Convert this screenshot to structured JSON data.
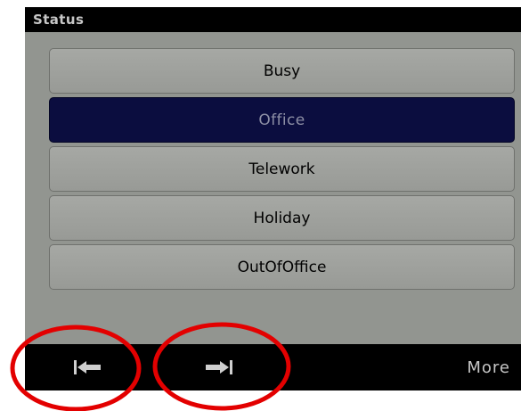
{
  "header": {
    "title": "Status"
  },
  "status_options": [
    {
      "label": "Busy",
      "selected": false
    },
    {
      "label": "Office",
      "selected": true
    },
    {
      "label": "Telework",
      "selected": false
    },
    {
      "label": "Holiday",
      "selected": false
    },
    {
      "label": "OutOfOffice",
      "selected": false
    }
  ],
  "softkeys": {
    "prev_icon": "arrow-left-to-bar-icon",
    "next_icon": "arrow-right-to-bar-icon",
    "more_label": "More"
  },
  "colors": {
    "screen_background": "#929590",
    "bar_background": "#000000",
    "selected_background": "#0b0d3f",
    "annotation_circle": "#e30000"
  }
}
